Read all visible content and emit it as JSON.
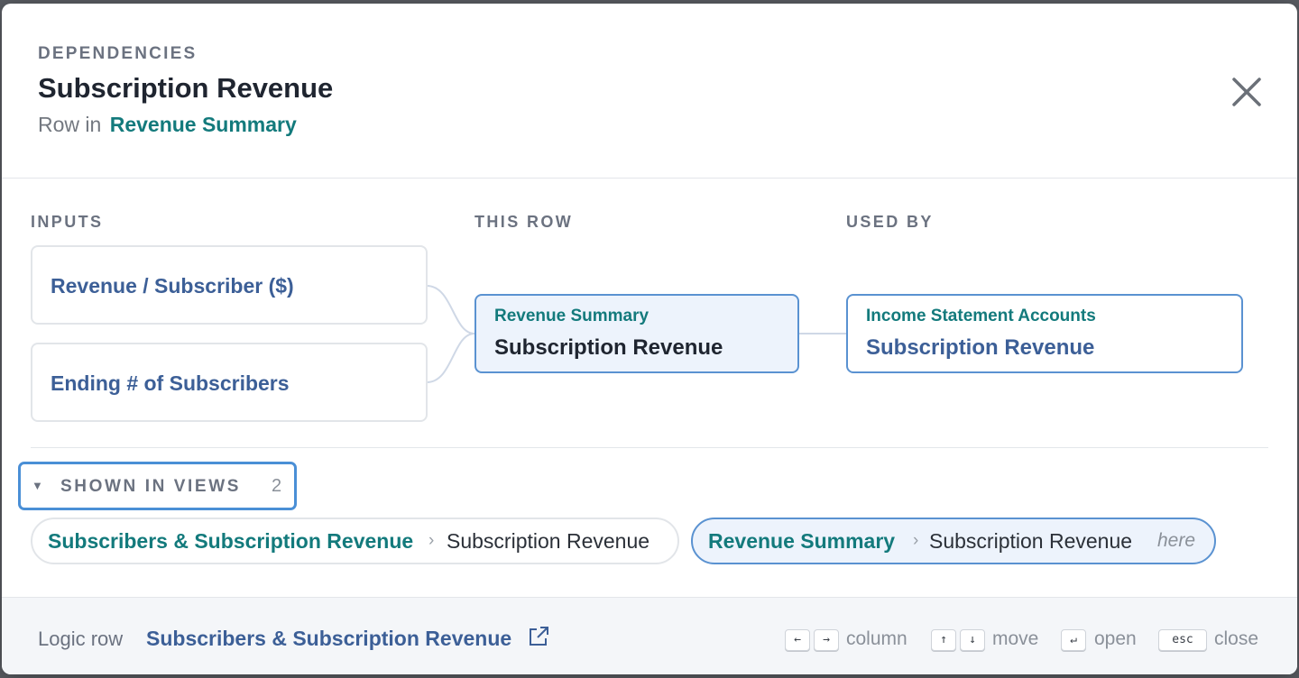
{
  "header": {
    "eyebrow": "DEPENDENCIES",
    "title": "Subscription Revenue",
    "subtitle_prefix": "Row in",
    "subtitle_link": "Revenue Summary"
  },
  "columns": {
    "inputs_label": "INPUTS",
    "this_row_label": "THIS ROW",
    "used_by_label": "USED BY"
  },
  "inputs": [
    {
      "label": "Revenue / Subscriber ($)"
    },
    {
      "label": "Ending # of Subscribers"
    }
  ],
  "this_row": {
    "sheet": "Revenue Summary",
    "row": "Subscription Revenue"
  },
  "used_by": [
    {
      "sheet": "Income Statement Accounts",
      "row": "Subscription Revenue"
    }
  ],
  "views": {
    "toggle_label": "SHOWN IN VIEWS",
    "count": "2",
    "items": [
      {
        "view": "Subscribers & Subscription Revenue",
        "separator": "›",
        "row": "Subscription Revenue"
      },
      {
        "view": "Revenue Summary",
        "separator": "›",
        "row": "Subscription Revenue",
        "here_label": "here"
      }
    ]
  },
  "footer": {
    "lead": "Logic row",
    "logic_link": "Subscribers & Subscription Revenue",
    "shortcuts": {
      "left_key": "←",
      "right_key": "→",
      "column_label": "column",
      "up_key": "↑",
      "down_key": "↓",
      "move_label": "move",
      "enter_key": "↵",
      "open_label": "open",
      "esc_key": "esc",
      "close_label": "close"
    }
  },
  "colors": {
    "accent_teal": "#137a7c",
    "link_blue": "#3c5f97",
    "focus_blue": "#4a8fd6",
    "selected_bg": "#edf3fc"
  },
  "icons": {
    "close": "close-icon",
    "caret": "caret-down-icon",
    "external": "external-link-icon"
  }
}
